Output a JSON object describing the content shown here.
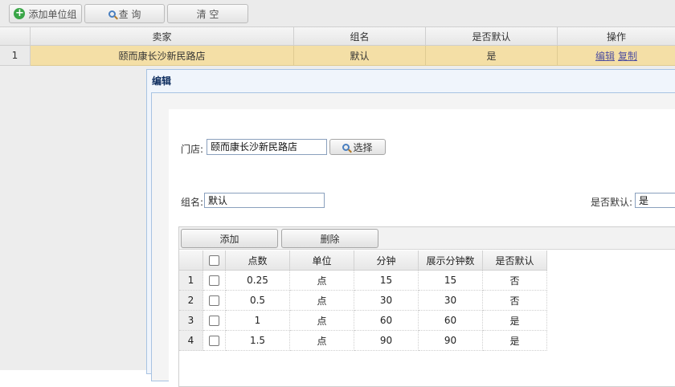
{
  "toolbar": {
    "add_group": "添加单位组",
    "query": "查 询",
    "clear": "清 空"
  },
  "grid": {
    "headers": [
      "卖家",
      "组名",
      "是否默认",
      "操作"
    ],
    "rows": [
      {
        "num": "1",
        "seller": "颐而康长沙新民路店",
        "group": "默认",
        "is_default": "是",
        "edit": "编辑",
        "copy": "复制"
      }
    ]
  },
  "dialog": {
    "title": "编辑",
    "store_label": "门店:",
    "store_value": "颐而康长沙新民路店",
    "select_button": "选择",
    "group_label": "组名:",
    "group_value": "默认",
    "default_label": "是否默认:",
    "default_value": "是",
    "add_button": "添加",
    "delete_button": "删除",
    "sub_headers": [
      "点数",
      "单位",
      "分钟",
      "展示分钟数",
      "是否默认"
    ],
    "sub_rows": [
      {
        "num": "1",
        "points": "0.25",
        "unit": "点",
        "minutes": "15",
        "display_minutes": "15",
        "is_default": "否"
      },
      {
        "num": "2",
        "points": "0.5",
        "unit": "点",
        "minutes": "30",
        "display_minutes": "30",
        "is_default": "否"
      },
      {
        "num": "3",
        "points": "1",
        "unit": "点",
        "minutes": "60",
        "display_minutes": "60",
        "is_default": "是"
      },
      {
        "num": "4",
        "points": "1.5",
        "unit": "点",
        "minutes": "90",
        "display_minutes": "90",
        "is_default": "是"
      }
    ]
  }
}
